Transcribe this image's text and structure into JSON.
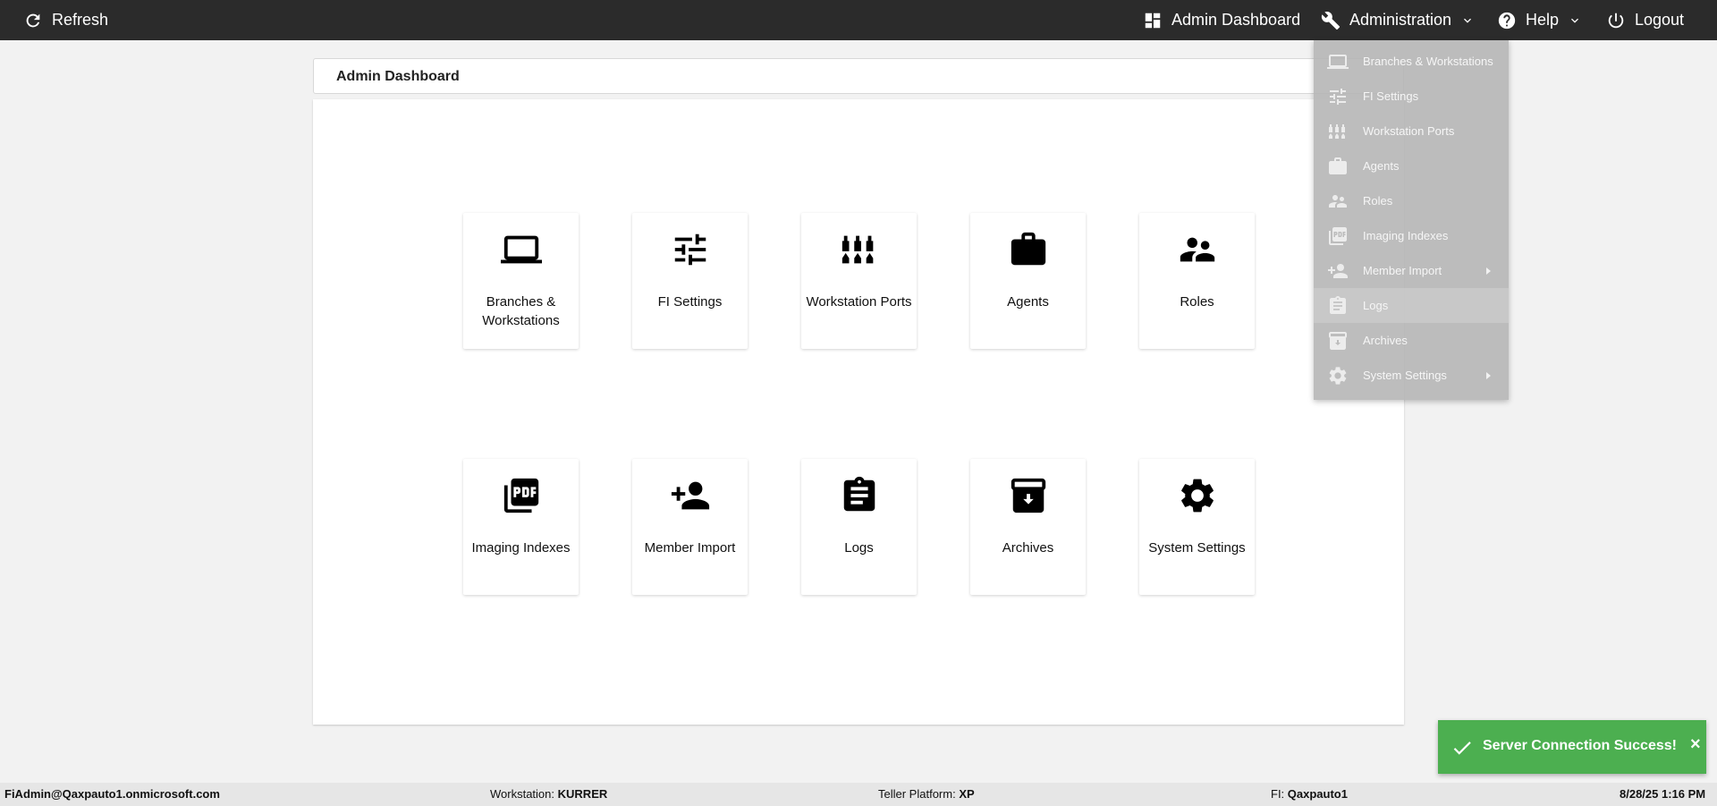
{
  "topbar": {
    "refresh_label": "Refresh",
    "admin_dashboard_label": "Admin Dashboard",
    "administration_label": "Administration",
    "help_label": "Help",
    "logout_label": "Logout"
  },
  "page": {
    "title": "Admin Dashboard"
  },
  "tiles": [
    {
      "label": "Branches & Workstations",
      "icon": "laptop-icon"
    },
    {
      "label": "FI Settings",
      "icon": "tune-icon"
    },
    {
      "label": "Workstation Ports",
      "icon": "ports-icon"
    },
    {
      "label": "Agents",
      "icon": "briefcase-icon"
    },
    {
      "label": "Roles",
      "icon": "people-icon"
    },
    {
      "label": "Imaging Indexes",
      "icon": "pdf-icon"
    },
    {
      "label": "Member Import",
      "icon": "person-add-icon"
    },
    {
      "label": "Logs",
      "icon": "clipboard-icon"
    },
    {
      "label": "Archives",
      "icon": "archive-icon"
    },
    {
      "label": "System Settings",
      "icon": "gear-icon"
    }
  ],
  "administration_menu": {
    "items": [
      {
        "label": "Branches & Workstations",
        "icon": "laptop-icon"
      },
      {
        "label": "FI Settings",
        "icon": "tune-icon"
      },
      {
        "label": "Workstation Ports",
        "icon": "ports-icon"
      },
      {
        "label": "Agents",
        "icon": "briefcase-icon"
      },
      {
        "label": "Roles",
        "icon": "people-icon"
      },
      {
        "label": "Imaging Indexes",
        "icon": "pdf-icon"
      },
      {
        "label": "Member Import",
        "icon": "person-add-icon",
        "has_submenu": true
      },
      {
        "label": "Logs",
        "icon": "clipboard-icon",
        "highlighted": true
      },
      {
        "label": "Archives",
        "icon": "archive-icon"
      },
      {
        "label": "System Settings",
        "icon": "gear-icon",
        "has_submenu": true
      }
    ]
  },
  "toast": {
    "message": "Server Connection Success!",
    "close_label": "×",
    "color": "#4caf50"
  },
  "statusbar": {
    "user": "FiAdmin@Qaxpauto1.onmicrosoft.com",
    "workstation_label": "Workstation:",
    "workstation_value": "KURRER",
    "teller_platform_label": "Teller Platform:",
    "teller_platform_value": "XP",
    "fi_label": "FI:",
    "fi_value": "Qaxpauto1",
    "datetime": "8/28/25 1:16 PM"
  }
}
